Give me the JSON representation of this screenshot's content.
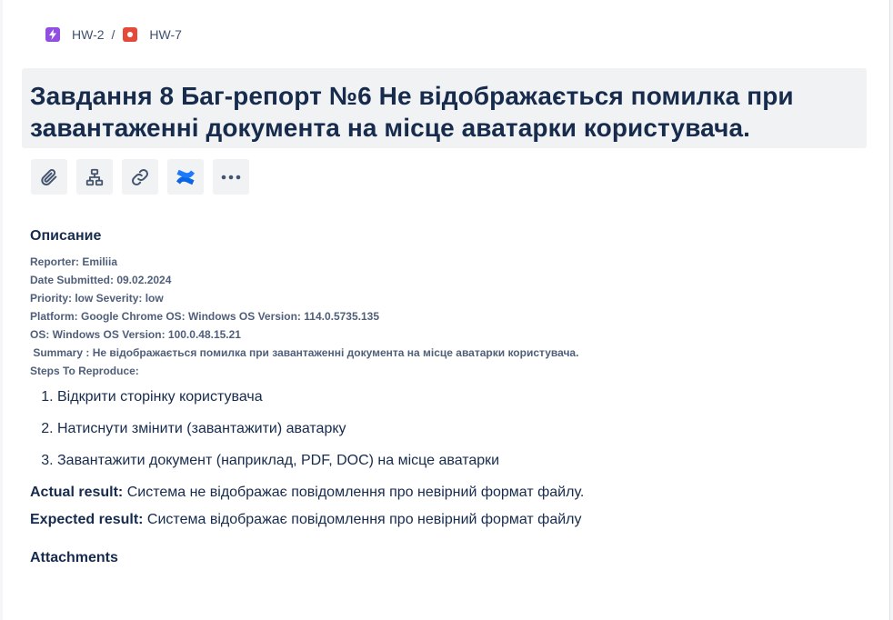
{
  "breadcrumb": {
    "parent": {
      "key": "HW-2",
      "icon": "epic-lightning-icon",
      "color": "#904ee2"
    },
    "separator": "/",
    "current": {
      "key": "HW-7",
      "icon": "bug-icon",
      "color": "#e5493a"
    }
  },
  "issue": {
    "title": "Завдання 8 Баг-репорт №6 Не відображається помилка при завантаженні документа на місце аватарки користувача."
  },
  "toolbar": [
    {
      "name": "attach-button",
      "icon": "paperclip-icon"
    },
    {
      "name": "child-issue-button",
      "icon": "hierarchy-icon"
    },
    {
      "name": "link-issue-button",
      "icon": "link-icon"
    },
    {
      "name": "confluence-button",
      "icon": "confluence-icon",
      "color": "#0c66e4"
    },
    {
      "name": "more-actions-button",
      "icon": "more-icon"
    }
  ],
  "description": {
    "heading": "Описание",
    "meta": [
      "Reporter: Emiliia",
      "Date Submitted: 09.02.2024",
      "Priority: low Severity: low",
      "Platform: Google Chrome OS: Windows OS Version: 114.0.5735.135",
      "OS: Windows OS Version: 100.0.48.15.21",
      " Summary : Не відображається помилка при завантаженні документа на місце аватарки користувача.",
      "Steps To Reproduce:"
    ],
    "steps": [
      "Відкрити сторінку користувача",
      "Натиснути змінити (завантажити) аватарку",
      "Завантажити документ (наприклад, PDF, DOC) на місце аватарки"
    ],
    "actual": {
      "label": "Actual result:",
      "text": " Система не відображає повідомлення про невірний формат файлу."
    },
    "expected": {
      "label": "Expected result:",
      "text": " Система відображає повідомлення про невірний формат файлу"
    },
    "attachments_heading": "Attachments"
  }
}
